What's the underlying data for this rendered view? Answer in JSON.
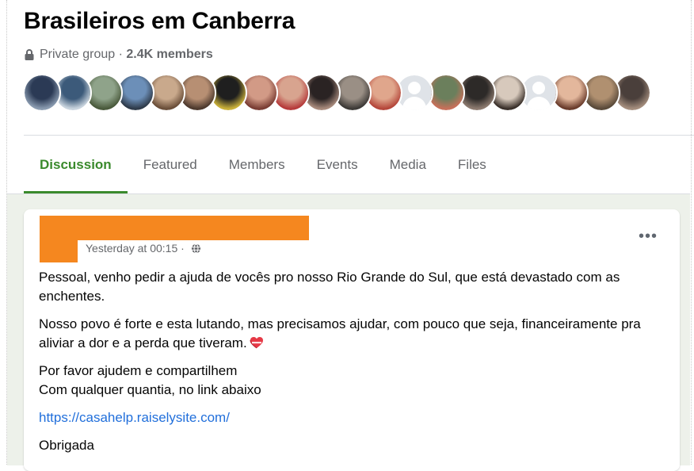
{
  "group": {
    "title": "Brasileiros em Canberra",
    "privacy": "Private group",
    "separator": " · ",
    "members_count": "2.4K members",
    "privacy_icon": "lock-icon"
  },
  "member_avatars": [
    {
      "name": "member-avatar-1",
      "colors": [
        "#2b3a55",
        "#8a9bb0"
      ]
    },
    {
      "name": "member-avatar-2",
      "colors": [
        "#3c5a7a",
        "#c9d4de"
      ]
    },
    {
      "name": "member-avatar-3",
      "colors": [
        "#8fa38a",
        "#4a5a3c"
      ]
    },
    {
      "name": "member-avatar-4",
      "colors": [
        "#6c8fb8",
        "#2f3b4a"
      ]
    },
    {
      "name": "member-avatar-5",
      "colors": [
        "#c9a98c",
        "#6b4f3a"
      ]
    },
    {
      "name": "member-avatar-6",
      "colors": [
        "#b78f73",
        "#4e3a2e"
      ]
    },
    {
      "name": "member-avatar-7",
      "colors": [
        "#1f1f1f",
        "#c9b03a"
      ]
    },
    {
      "name": "member-avatar-8",
      "colors": [
        "#d29a86",
        "#7a3d34"
      ]
    },
    {
      "name": "member-avatar-9",
      "colors": [
        "#d8a48f",
        "#b63b3b"
      ]
    },
    {
      "name": "member-avatar-10",
      "colors": [
        "#2a2323",
        "#a88a7c"
      ]
    },
    {
      "name": "member-avatar-11",
      "colors": [
        "#9a8f85",
        "#3d3a37"
      ]
    },
    {
      "name": "member-avatar-12",
      "colors": [
        "#e0a68c",
        "#b5473b"
      ]
    },
    {
      "name": "member-avatar-13",
      "blank": true
    },
    {
      "name": "member-avatar-14",
      "colors": [
        "#6b7f5c",
        "#c7705a"
      ]
    },
    {
      "name": "member-avatar-15",
      "colors": [
        "#2d2a28",
        "#8c7a6f"
      ]
    },
    {
      "name": "member-avatar-16",
      "colors": [
        "#d7c9bc",
        "#3a302a"
      ]
    },
    {
      "name": "member-avatar-17",
      "blank": true
    },
    {
      "name": "member-avatar-18",
      "colors": [
        "#e3b79c",
        "#6a3c2c"
      ]
    },
    {
      "name": "member-avatar-19",
      "colors": [
        "#b09070",
        "#5a4a3a"
      ]
    },
    {
      "name": "member-avatar-20",
      "colors": [
        "#4a3f3b",
        "#a48d7d"
      ]
    }
  ],
  "tabs": [
    {
      "label": "Discussion",
      "active": true
    },
    {
      "label": "Featured",
      "active": false
    },
    {
      "label": "Members",
      "active": false
    },
    {
      "label": "Events",
      "active": false
    },
    {
      "label": "Media",
      "active": false
    },
    {
      "label": "Files",
      "active": false
    }
  ],
  "post": {
    "author_redacted": true,
    "redaction_color": "#f5871f",
    "timestamp": "Yesterday at 00:15",
    "timestamp_separator": " · ",
    "audience_icon": "globe-icon",
    "more_label": "•••",
    "paragraphs": {
      "p1": "Pessoal, venho pedir a ajuda de vocês pro nosso Rio Grande do Sul, que está devastado com as enchentes.",
      "p2": "Nosso povo é forte e esta lutando, mas precisamos ajudar, com pouco que seja, financeiramente pra aliviar a dor e a perda que tiveram.",
      "p3_line1": "Por favor ajudem e compartilhem",
      "p3_line2": "Com qualquer quantia, no link abaixo",
      "link": "https://casahelp.raiselysite.com/",
      "closing": "Obrigada"
    },
    "emoji": "heart-icon"
  },
  "colors": {
    "accent_green": "#3a8a2c",
    "link_blue": "#216fdb",
    "feed_background": "#edf1ea"
  }
}
